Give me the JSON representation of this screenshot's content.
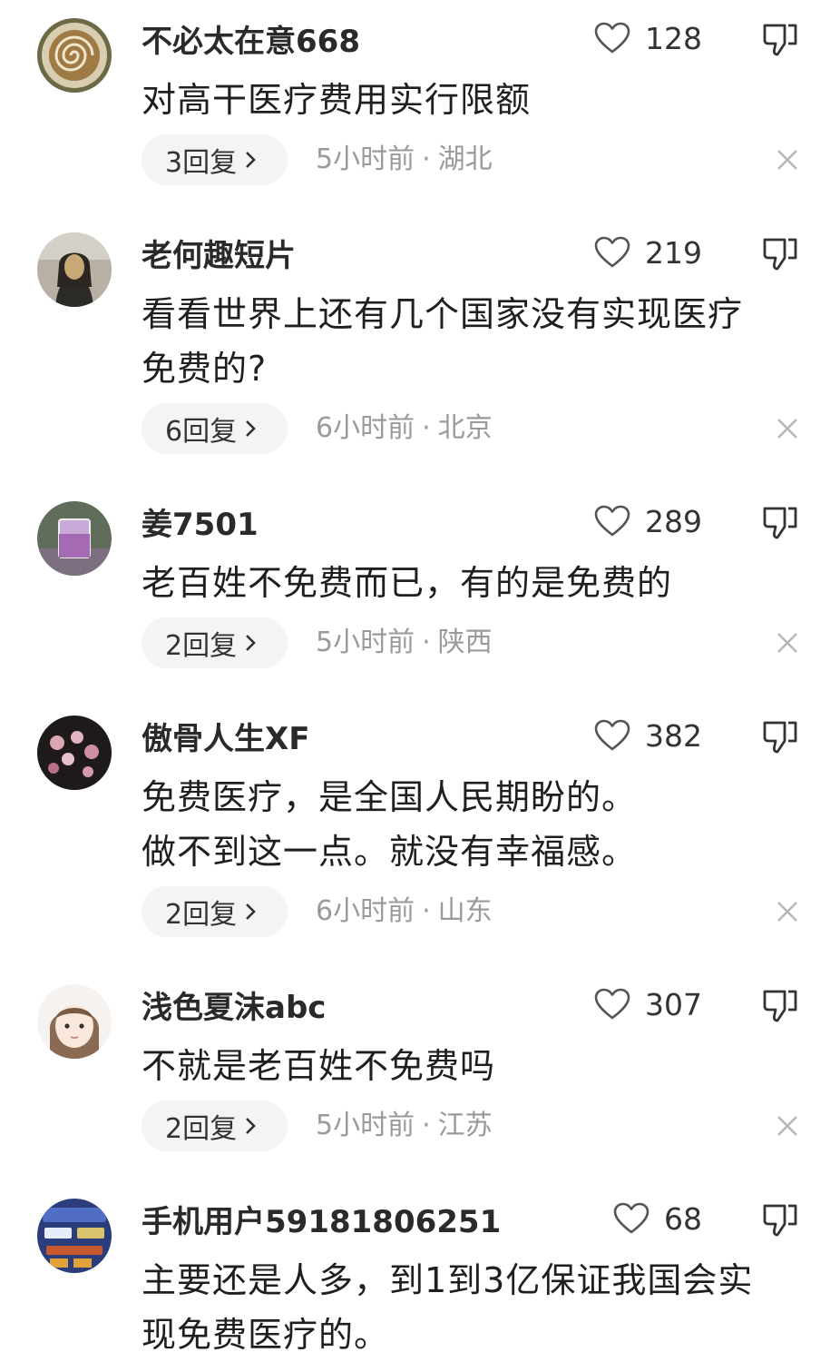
{
  "comments": [
    {
      "username": "不必太在意668",
      "likes": "128",
      "lines": [
        "对高干医疗费用实行限额"
      ],
      "replies": "3回复",
      "time": "5小时前",
      "region": "湖北",
      "avatar": "coffee-avatar"
    },
    {
      "username": "老何趣短片",
      "likes": "219",
      "lines": [
        "看看世界上还有几个国家没有实现医疗",
        "免费的?"
      ],
      "replies": "6回复",
      "time": "6小时前",
      "region": "北京",
      "avatar": "portrait-avatar"
    },
    {
      "username": "姜7501",
      "likes": "289",
      "lines": [
        "老百姓不免费而已，有的是免费的"
      ],
      "replies": "2回复",
      "time": "5小时前",
      "region": "陕西",
      "avatar": "glass-avatar"
    },
    {
      "username": "傲骨人生XF",
      "likes": "382",
      "lines": [
        "免费医疗，是全国人民期盼的。",
        "做不到这一点。就没有幸福感。"
      ],
      "replies": "2回复",
      "time": "6小时前",
      "region": "山东",
      "avatar": "flowers-avatar"
    },
    {
      "username": "浅色夏沫abc",
      "likes": "307",
      "lines": [
        "不就是老百姓不免费吗"
      ],
      "replies": "2回复",
      "time": "5小时前",
      "region": "江苏",
      "avatar": "cartoon-girl-avatar"
    },
    {
      "username": "手机用户59181806251",
      "likes": "68",
      "lines": [
        "主要还是人多，到1到3亿保证我国会实",
        "现免费医疗的。"
      ],
      "avatar": "game-screenshot-avatar"
    }
  ],
  "icons": {
    "like": "heart-outline-icon",
    "dislike": "thumbs-down-icon",
    "replies_arrow": "chevron-right-icon",
    "close": "close-icon"
  },
  "colors": {
    "text": "#1f1f1f",
    "meta": "#9a9a9a",
    "pill_bg": "#f4f4f4"
  }
}
